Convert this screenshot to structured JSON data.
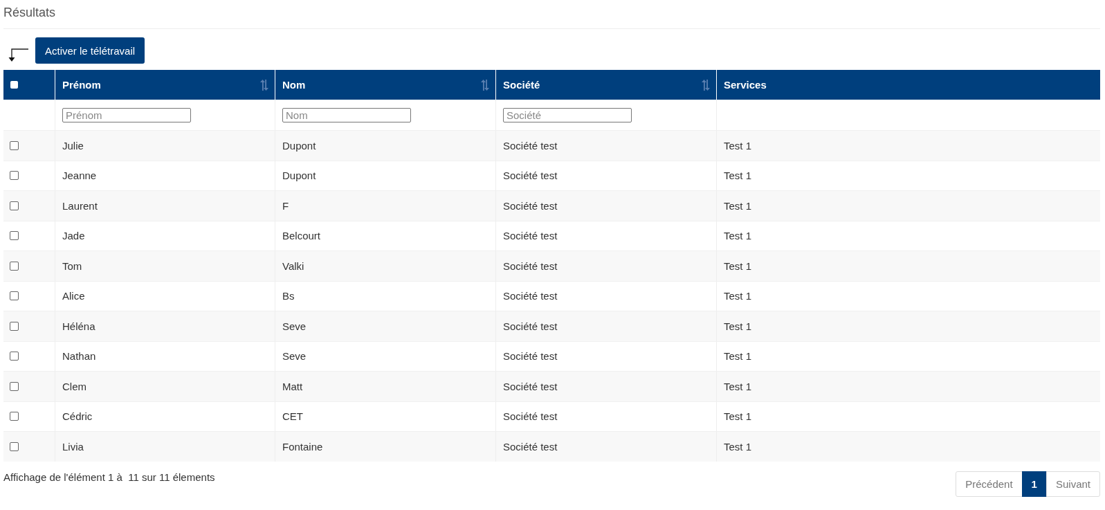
{
  "title": "Résultats",
  "action_button": {
    "label": "Activer le télétravail"
  },
  "table": {
    "select_all": {
      "checked": false
    },
    "columns": [
      {
        "label": "Prénom",
        "sortable": true,
        "filter_placeholder": "Prénom"
      },
      {
        "label": "Nom",
        "sortable": true,
        "filter_placeholder": "Nom"
      },
      {
        "label": "Société",
        "sortable": true,
        "filter_placeholder": "Société"
      },
      {
        "label": "Services",
        "sortable": false
      }
    ],
    "rows": [
      {
        "checked": false,
        "cells": [
          "Julie",
          "Dupont",
          "Société test",
          "Test 1"
        ]
      },
      {
        "checked": false,
        "cells": [
          "Jeanne",
          "Dupont",
          "Société test",
          "Test 1"
        ]
      },
      {
        "checked": false,
        "cells": [
          "Laurent",
          "F",
          "Société test",
          "Test 1"
        ]
      },
      {
        "checked": false,
        "cells": [
          "Jade",
          "Belcourt",
          "Société test",
          "Test 1"
        ]
      },
      {
        "checked": false,
        "cells": [
          "Tom",
          "Valki",
          "Société test",
          "Test 1"
        ]
      },
      {
        "checked": false,
        "cells": [
          "Alice",
          "Bs",
          "Société test",
          "Test 1"
        ]
      },
      {
        "checked": false,
        "cells": [
          "Héléna",
          "Seve",
          "Société test",
          "Test 1"
        ]
      },
      {
        "checked": false,
        "cells": [
          "Nathan",
          "Seve",
          "Société test",
          "Test 1"
        ]
      },
      {
        "checked": false,
        "cells": [
          "Clem",
          "Matt",
          "Société test",
          "Test 1"
        ]
      },
      {
        "checked": false,
        "cells": [
          "Cédric",
          "CET",
          "Société test",
          "Test 1"
        ]
      },
      {
        "checked": false,
        "cells": [
          "Livia",
          "Fontaine",
          "Société test",
          "Test 1"
        ]
      }
    ]
  },
  "info": "Affichage de l'élément 1 à  11 sur 11 élements",
  "pagination": {
    "previous": "Précédent",
    "pages": [
      {
        "label": "1",
        "selected": true
      }
    ],
    "next": "Suivant"
  }
}
